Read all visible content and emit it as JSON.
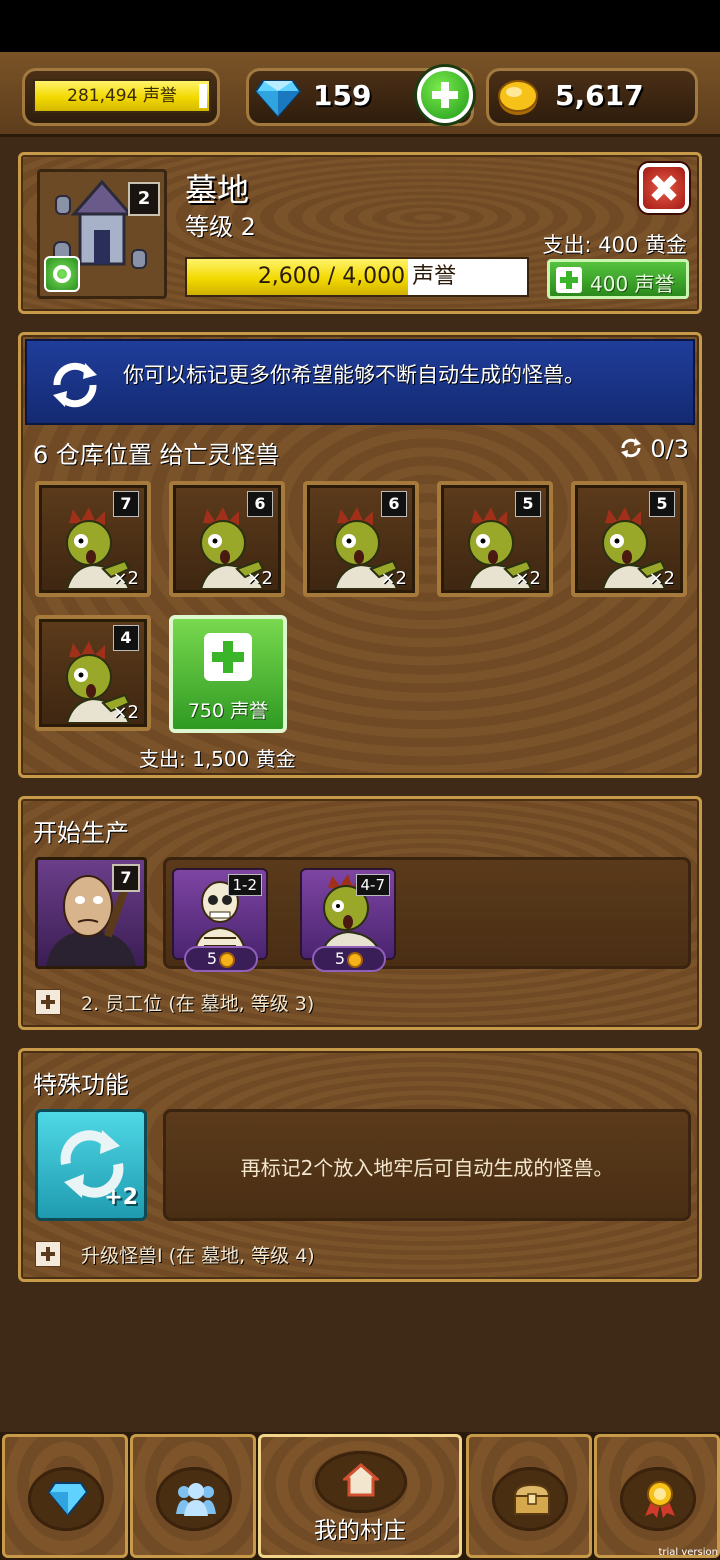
{
  "header": {
    "reputation": "281,494 声誉",
    "gems": "159",
    "gold": "5,617"
  },
  "building": {
    "name": "墓地",
    "level_text": "等级 2",
    "level_badge": "2",
    "expense": "支出: 400 黄金",
    "progress_text": "2,600 / 4,000 声誉",
    "progress_fraction": 0.65,
    "upgrade_button": "400 声誉"
  },
  "storage": {
    "banner_text": "你可以标记更多你希望能够不断自动生成的怪兽。",
    "title": "6 仓库位置 给亡灵怪兽",
    "auto_count": "0/3",
    "slots": [
      {
        "level": "7",
        "count": "×2"
      },
      {
        "level": "6",
        "count": "×2"
      },
      {
        "level": "6",
        "count": "×2"
      },
      {
        "level": "5",
        "count": "×2"
      },
      {
        "level": "5",
        "count": "×2"
      },
      {
        "level": "4",
        "count": "×2"
      }
    ],
    "add_slot_label": "750 声誉",
    "expense": "支出: 1,500 黄金"
  },
  "production": {
    "title": "开始生产",
    "worker_level": "7",
    "queue": [
      {
        "range": "1-2",
        "cost": "5",
        "monster": "skeleton"
      },
      {
        "range": "4-7",
        "cost": "5",
        "monster": "zombie"
      }
    ],
    "note": "2. 员工位 (在 墓地, 等级 3)"
  },
  "special": {
    "title": "特殊功能",
    "icon_badge": "+2",
    "description": "再标记2个放入地牢后可自动生成的怪兽。",
    "note": "升级怪兽I (在 墓地, 等级 4)"
  },
  "nav": {
    "items": [
      {
        "icon": "gem-icon",
        "label": ""
      },
      {
        "icon": "people-icon",
        "label": ""
      },
      {
        "icon": "house-icon",
        "label": "我的村庄"
      },
      {
        "icon": "chest-icon",
        "label": ""
      },
      {
        "icon": "medal-icon",
        "label": ""
      }
    ]
  },
  "watermark": "trial version",
  "colors": {
    "wood": "#7b532a",
    "banner_blue": "#1f3d9a",
    "green": "#3ab52a",
    "reputation_yellow": "#f2d900"
  }
}
